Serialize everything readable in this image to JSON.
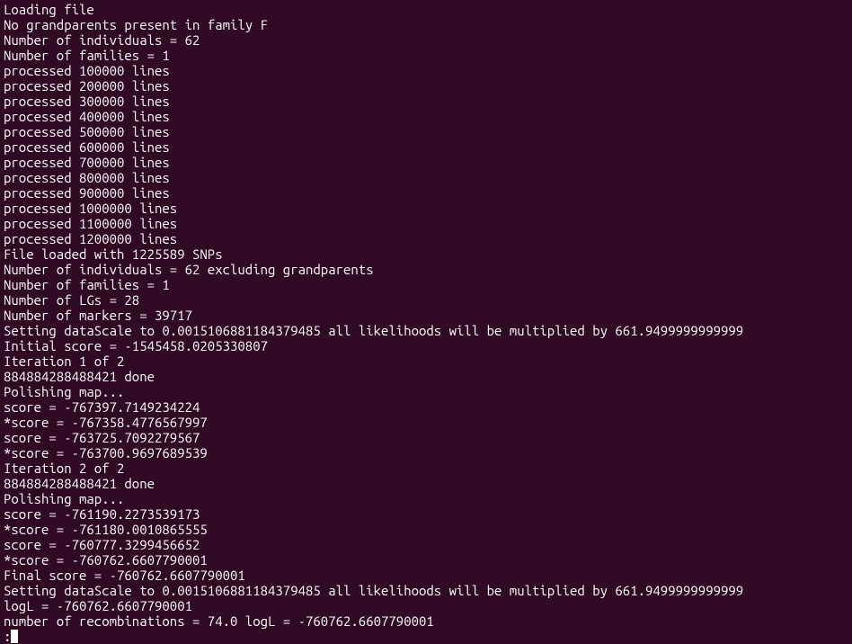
{
  "lines": [
    "Loading file",
    "No grandparents present in family F",
    "Number of individuals = 62",
    "Number of families = 1",
    "processed 100000 lines",
    "processed 200000 lines",
    "processed 300000 lines",
    "processed 400000 lines",
    "processed 500000 lines",
    "processed 600000 lines",
    "processed 700000 lines",
    "processed 800000 lines",
    "processed 900000 lines",
    "processed 1000000 lines",
    "processed 1100000 lines",
    "processed 1200000 lines",
    "File loaded with 1225589 SNPs",
    "Number of individuals = 62 excluding grandparents",
    "Number of families = 1",
    "Number of LGs = 28",
    "Number of markers = 39717",
    "Setting dataScale to 0.0015106881184379485 all likelihoods will be multiplied by 661.9499999999999",
    "Initial score = -1545458.0205330807",
    "Iteration 1 of 2",
    "884884288488421 done",
    "Polishing map...",
    "score = -767397.7149234224",
    "*score = -767358.4776567997",
    "score = -763725.7092279567",
    "*score = -763700.9697689539",
    "Iteration 2 of 2",
    "884884288488421 done",
    "Polishing map...",
    "score = -761190.2273539173",
    "*score = -761180.0010865555",
    "score = -760777.3299456652",
    "*score = -760762.6607790001",
    "Final score = -760762.6607790001",
    "Setting dataScale to 0.0015106881184379485 all likelihoods will be multiplied by 661.9499999999999",
    "logL = -760762.6607790001",
    "number of recombinations = 74.0 logL = -760762.6607790001"
  ],
  "prompt": ":"
}
